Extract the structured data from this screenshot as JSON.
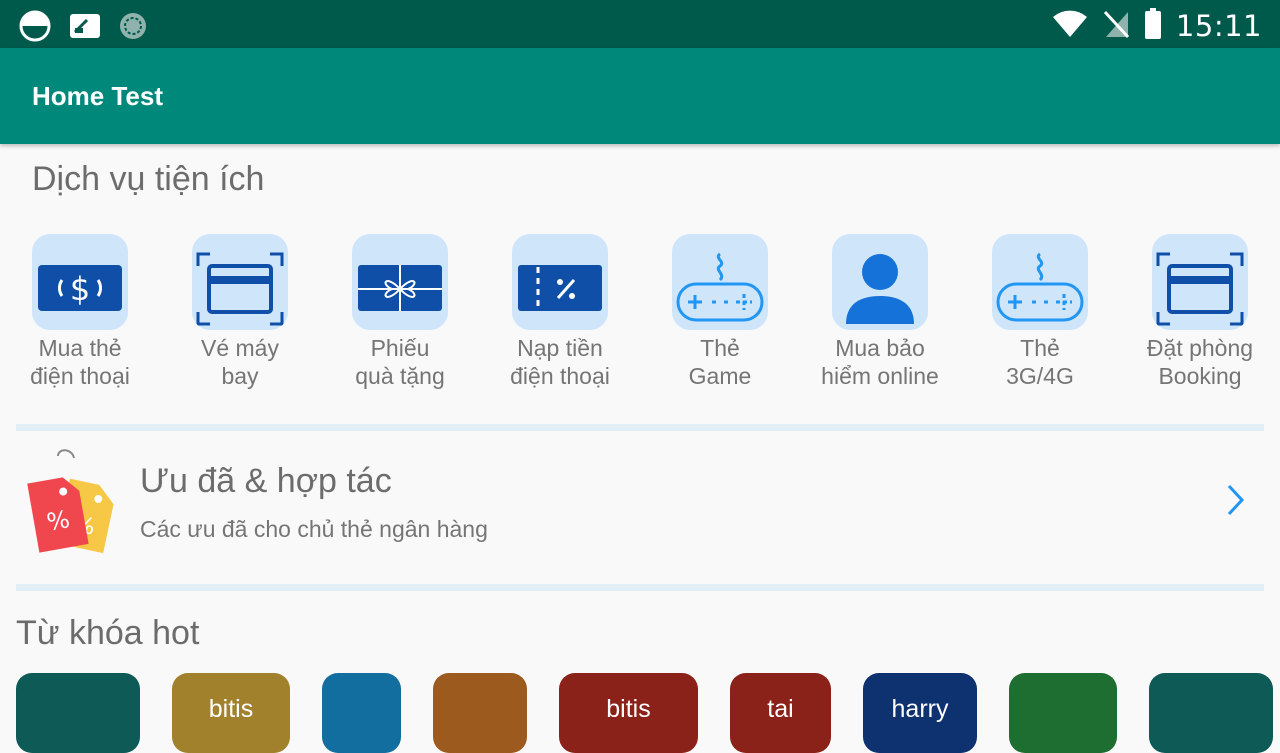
{
  "status_bar": {
    "time": "15:11",
    "icons": [
      "sim-status-icon",
      "screenshot-icon",
      "sync-icon",
      "wifi-icon",
      "no-signal-icon",
      "battery-icon"
    ]
  },
  "app_bar": {
    "title": "Home Test"
  },
  "services_section": {
    "title": "Dịch vụ tiện ích",
    "items": [
      {
        "line1": "Mua thẻ",
        "line2": "điện thoại",
        "icon": "money-card-icon"
      },
      {
        "line1": "Vé máy",
        "line2": "bay",
        "icon": "card-scan-icon"
      },
      {
        "line1": "Phiếu",
        "line2": "quà tặng",
        "icon": "gift-card-icon"
      },
      {
        "line1": "Nạp tiền",
        "line2": "điện thoại",
        "icon": "voucher-icon"
      },
      {
        "line1": "Thẻ",
        "line2": "Game",
        "icon": "gamepad-icon"
      },
      {
        "line1": "Mua bảo",
        "line2": "hiểm online",
        "icon": "person-icon"
      },
      {
        "line1": "Thẻ",
        "line2": "3G/4G",
        "icon": "gamepad-icon"
      },
      {
        "line1": "Đặt phòng",
        "line2": "Booking",
        "icon": "card-scan-icon"
      }
    ]
  },
  "promo": {
    "title": "Ưu đã & hợp tác",
    "subtitle": "Các ưu đã cho chủ thẻ ngân hàng",
    "icon": "discount-tag-icon",
    "chevron": "chevron-right-icon"
  },
  "keywords_section": {
    "title": "Từ khóa hot",
    "items": [
      {
        "label": "",
        "color": "#0e5a57"
      },
      {
        "label": "bitis",
        "color": "#a1812b"
      },
      {
        "label": "",
        "color": "#116e9e"
      },
      {
        "label": "",
        "color": "#9c5a1e"
      },
      {
        "label": "bitis",
        "color": "#8a2219"
      },
      {
        "label": "tai",
        "color": "#8a2219"
      },
      {
        "label": "harry",
        "color": "#0e3170"
      },
      {
        "label": "",
        "color": "#1e6e31"
      },
      {
        "label": "",
        "color": "#0e5a57"
      }
    ]
  }
}
